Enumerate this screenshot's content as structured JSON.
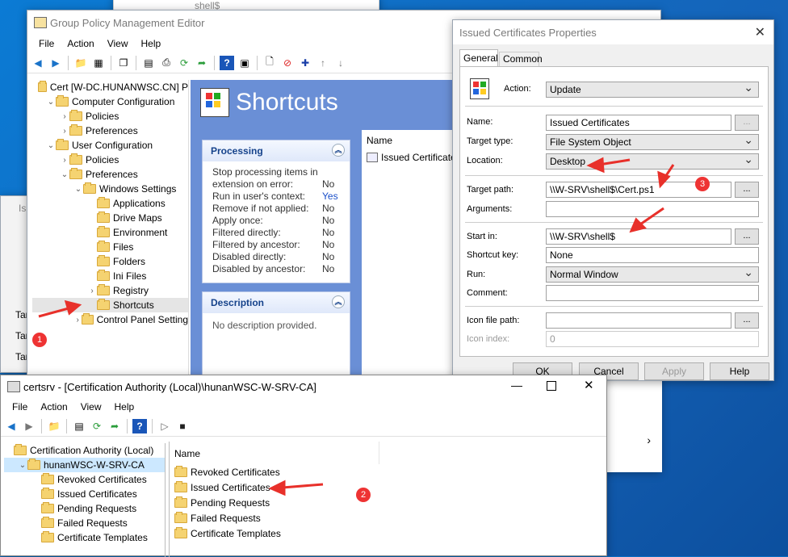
{
  "colors": {
    "accent": "#0078d7",
    "arrow": "#e8302a",
    "mmc_blue": "#6a8fd6",
    "panel_title": "#15428b"
  },
  "taskbar_top": {
    "text": "shell$"
  },
  "gpme": {
    "title": "Group Policy Management Editor",
    "menu": [
      "File",
      "Action",
      "View",
      "Help"
    ],
    "tree": [
      {
        "label": "Cert [W-DC.HUNANWSC.CN] P",
        "indent": 0,
        "chev": ""
      },
      {
        "label": "Computer Configuration",
        "indent": 1,
        "chev": "⌄"
      },
      {
        "label": "Policies",
        "indent": 2,
        "chev": "›"
      },
      {
        "label": "Preferences",
        "indent": 2,
        "chev": "›"
      },
      {
        "label": "User Configuration",
        "indent": 1,
        "chev": "⌄"
      },
      {
        "label": "Policies",
        "indent": 2,
        "chev": "›"
      },
      {
        "label": "Preferences",
        "indent": 2,
        "chev": "⌄"
      },
      {
        "label": "Windows Settings",
        "indent": 3,
        "chev": "⌄"
      },
      {
        "label": "Applications",
        "indent": 4,
        "chev": ""
      },
      {
        "label": "Drive Maps",
        "indent": 4,
        "chev": ""
      },
      {
        "label": "Environment",
        "indent": 4,
        "chev": ""
      },
      {
        "label": "Files",
        "indent": 4,
        "chev": ""
      },
      {
        "label": "Folders",
        "indent": 4,
        "chev": ""
      },
      {
        "label": "Ini Files",
        "indent": 4,
        "chev": ""
      },
      {
        "label": "Registry",
        "indent": 4,
        "chev": "›"
      },
      {
        "label": "Shortcuts",
        "indent": 4,
        "chev": ""
      },
      {
        "label": "Control Panel Setting",
        "indent": 3,
        "chev": "›"
      }
    ],
    "heading": "Shortcuts",
    "processing": {
      "title": "Processing",
      "rows": [
        {
          "k": "Stop processing items in",
          "v": ""
        },
        {
          "k": "extension on error:",
          "v": "No"
        },
        {
          "k": "Run in user's context:",
          "v": "Yes"
        },
        {
          "k": "Remove if not applied:",
          "v": "No"
        },
        {
          "k": "Apply once:",
          "v": "No"
        },
        {
          "k": "Filtered directly:",
          "v": "No"
        },
        {
          "k": "Filtered by ancestor:",
          "v": "No"
        },
        {
          "k": "Disabled directly:",
          "v": "No"
        },
        {
          "k": "Disabled by ancestor:",
          "v": "No"
        }
      ]
    },
    "description": {
      "title": "Description",
      "text": "No description provided."
    },
    "list_header": "Name",
    "list_item": "Issued Certificate"
  },
  "left_stub": {
    "labels": [
      "Is",
      "Tar",
      "Tar",
      "Tar"
    ]
  },
  "props": {
    "title": "Issued Certificates Properties",
    "tabs": [
      "General",
      "Common"
    ],
    "action_label": "Action:",
    "action_value": "Update",
    "name_label": "Name:",
    "name_value": "Issued Certificates",
    "target_type_label": "Target type:",
    "target_type_value": "File System Object",
    "location_label": "Location:",
    "location_value": "Desktop",
    "target_path_label": "Target path:",
    "target_path_value": "\\\\W-SRV\\shell$\\Cert.ps1",
    "arguments_label": "Arguments:",
    "arguments_value": "",
    "start_in_label": "Start in:",
    "start_in_value": "\\\\W-SRV\\shell$",
    "shortcut_key_label": "Shortcut key:",
    "shortcut_key_value": "None",
    "run_label": "Run:",
    "run_value": "Normal Window",
    "comment_label": "Comment:",
    "comment_value": "",
    "icon_path_label": "Icon file path:",
    "icon_path_value": "",
    "icon_index_label": "Icon index:",
    "icon_index_value": "0",
    "dots": "...",
    "ok": "OK",
    "cancel": "Cancel",
    "apply": "Apply",
    "help": "Help"
  },
  "certsrv": {
    "title": "certsrv - [Certification Authority (Local)\\hunanWSC-W-SRV-CA]",
    "menu": [
      "File",
      "Action",
      "View",
      "Help"
    ],
    "tree": [
      {
        "label": "Certification Authority (Local)",
        "indent": 0,
        "chev": ""
      },
      {
        "label": "hunanWSC-W-SRV-CA",
        "indent": 1,
        "chev": "⌄"
      },
      {
        "label": "Revoked Certificates",
        "indent": 2,
        "chev": ""
      },
      {
        "label": "Issued Certificates",
        "indent": 2,
        "chev": ""
      },
      {
        "label": "Pending Requests",
        "indent": 2,
        "chev": ""
      },
      {
        "label": "Failed Requests",
        "indent": 2,
        "chev": ""
      },
      {
        "label": "Certificate Templates",
        "indent": 2,
        "chev": ""
      }
    ],
    "list_header": "Name",
    "list": [
      "Revoked Certificates",
      "Issued Certificates",
      "Pending Requests",
      "Failed Requests",
      "Certificate Templates"
    ]
  },
  "badges": [
    "1",
    "2",
    "3"
  ]
}
